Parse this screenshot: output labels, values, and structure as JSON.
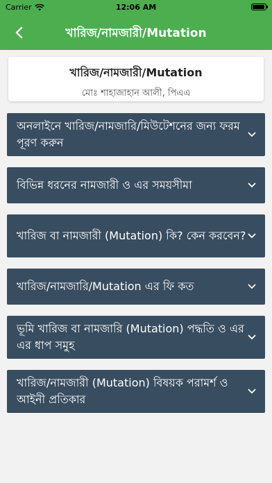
{
  "status_bar": {
    "carrier": "Carrier",
    "time": "12:06 AM"
  },
  "nav": {
    "title": "খারিজ/নামজারী/Mutation"
  },
  "header": {
    "title": "খারিজ/নামজারী/Mutation",
    "subtitle": "মোঃ শাহাজাহান আলী, পিএএ"
  },
  "items": [
    {
      "label": "অনলাইনে খারিজ/নামজারি/মিউটেশনের জন্য ফরম পূরণ করুন"
    },
    {
      "label": "বিভিন্ন ধরনের নামজারী ও এর সময়সীমা"
    },
    {
      "label": "খারিজ বা নামজারী (Mutation) কি? কেন করবেন?"
    },
    {
      "label": "খারিজ/নামজারি/Mutation এর ফি কত"
    },
    {
      "label": "ভূমি খারিজ বা নামজারি (Mutation) পদ্ধতি ও এর এর ধাপ সমুহ"
    },
    {
      "label": "খারিজ/নামজারী (Mutation) বিষয়ক পরামর্শ ও আইনী প্রতিকার"
    }
  ],
  "colors": {
    "primary": "#4cae4f",
    "item_bg": "#384d60"
  },
  "icons": {
    "back": "chevron-left-icon",
    "expand": "chevron-down-icon"
  }
}
